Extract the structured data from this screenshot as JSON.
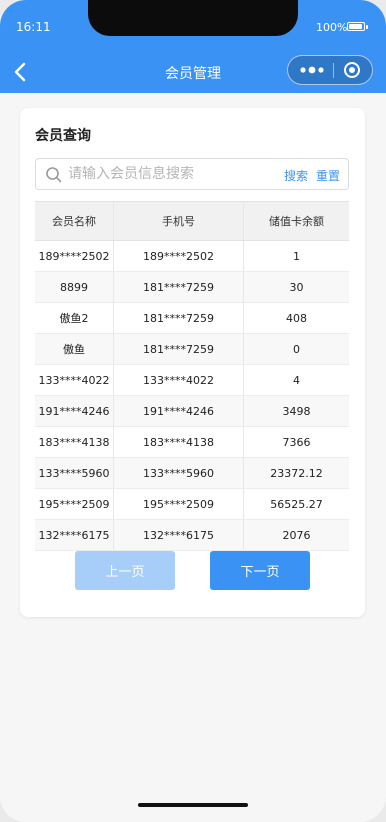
{
  "status_bar": {
    "time": "16:11",
    "battery": "100%"
  },
  "nav": {
    "title": "会员管理"
  },
  "card": {
    "title": "会员查询"
  },
  "search": {
    "placeholder": "请输入会员信息搜索",
    "value": "",
    "search_label": "搜索",
    "reset_label": "重置"
  },
  "table": {
    "headers": [
      "会员名称",
      "手机号",
      "储值卡余额"
    ],
    "rows": [
      [
        "189****2502",
        "189****2502",
        "1"
      ],
      [
        "8899",
        "181****7259",
        "30"
      ],
      [
        "傲鱼2",
        "181****7259",
        "408"
      ],
      [
        "傲鱼",
        "181****7259",
        "0"
      ],
      [
        "133****4022",
        "133****4022",
        "4"
      ],
      [
        "191****4246",
        "191****4246",
        "3498"
      ],
      [
        "183****4138",
        "183****4138",
        "7366"
      ],
      [
        "133****5960",
        "133****5960",
        "23372.12"
      ],
      [
        "195****2509",
        "195****2509",
        "56525.27"
      ],
      [
        "132****6175",
        "132****6175",
        "2076"
      ]
    ]
  },
  "pager": {
    "prev_label": "上一页",
    "next_label": "下一页"
  }
}
